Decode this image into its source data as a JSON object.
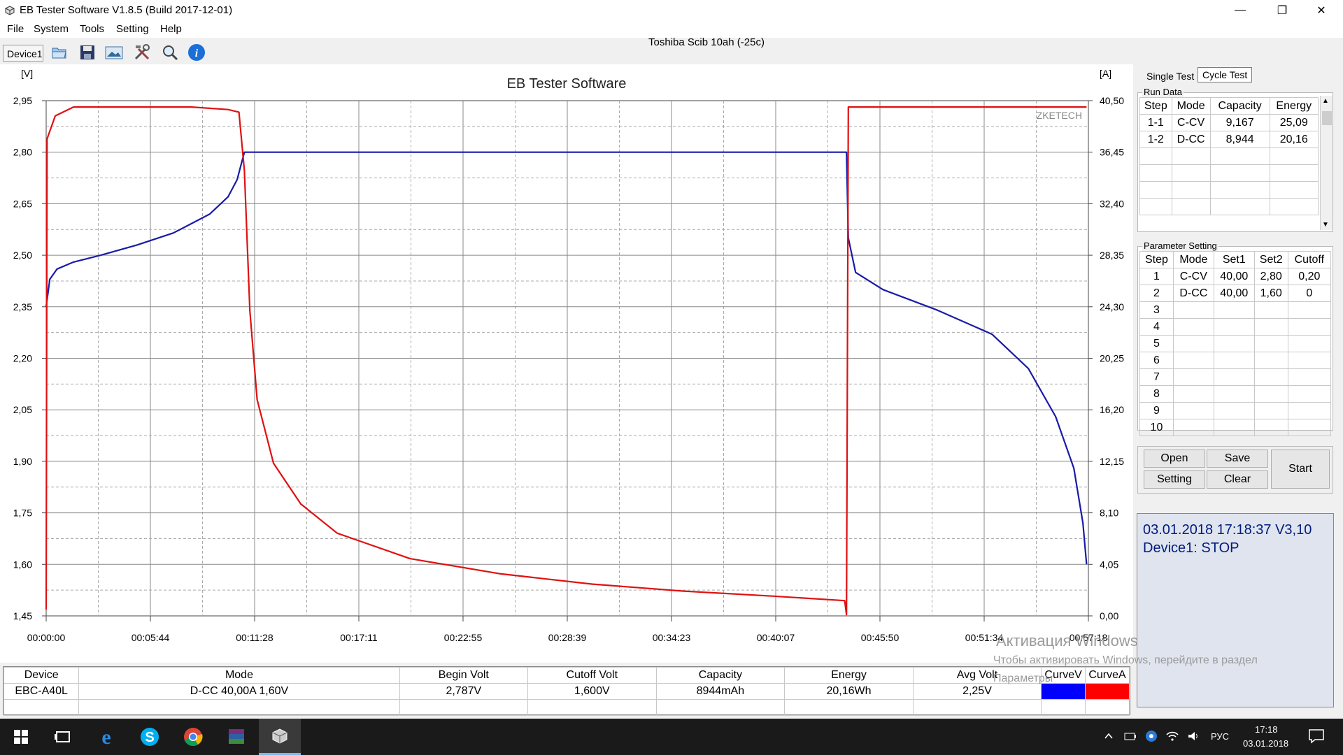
{
  "window": {
    "title": "EB Tester Software V1.8.5 (Build 2017-12-01)",
    "controls": [
      "minimize",
      "restore",
      "close"
    ]
  },
  "menu": [
    "File",
    "System",
    "Tools",
    "Setting",
    "Help"
  ],
  "toolbar": {
    "device_label": "Device1",
    "icons": [
      "open-folder-icon",
      "save-icon",
      "picture-icon",
      "tools-icon",
      "search-icon",
      "info-icon"
    ]
  },
  "document_title": "Toshiba Scib 10ah (-25c)",
  "chart": {
    "title": "EB Tester Software",
    "watermark": "ZKETECH",
    "left_unit": "[V]",
    "right_unit": "[A]",
    "left_ticks": [
      "2,95",
      "2,80",
      "2,65",
      "2,50",
      "2,35",
      "2,20",
      "2,05",
      "1,90",
      "1,75",
      "1,60",
      "1,45"
    ],
    "right_ticks": [
      "40,50",
      "36,45",
      "32,40",
      "28,35",
      "24,30",
      "20,25",
      "16,20",
      "12,15",
      "8,10",
      "4,05",
      "0,00"
    ],
    "x_ticks": [
      "00:00:00",
      "00:05:44",
      "00:11:28",
      "00:17:11",
      "00:22:55",
      "00:28:39",
      "00:34:23",
      "00:40:07",
      "00:45:50",
      "00:51:34",
      "00:57:18"
    ],
    "voltage_color": "#1a1aa8",
    "current_color": "#e01010"
  },
  "chart_data": {
    "type": "line",
    "title": "EB Tester Software",
    "xlabel": "",
    "ylabel": "[V]",
    "y2label": "[A]",
    "x_unit": "minutes",
    "xlim": [
      0,
      57.3
    ],
    "ylim": [
      1.45,
      2.95
    ],
    "y2lim": [
      0,
      40.5
    ],
    "grid": true,
    "series": [
      {
        "name": "",
        "axis": "left",
        "x": [
          0,
          0.2,
          0.6,
          1.5,
          3,
          5,
          7,
          9,
          10,
          10.5,
          10.75,
          10.9,
          11.1,
          20,
          30,
          40,
          43.9,
          44.0,
          44.1,
          44.5,
          46,
          49,
          52,
          54,
          55.5,
          56.5,
          57,
          57.2
        ],
        "y": [
          2.35,
          2.43,
          2.46,
          2.48,
          2.5,
          2.53,
          2.565,
          2.62,
          2.67,
          2.72,
          2.77,
          2.8,
          2.8,
          2.8,
          2.8,
          2.8,
          2.8,
          2.8,
          2.55,
          2.45,
          2.4,
          2.34,
          2.27,
          2.17,
          2.03,
          1.88,
          1.72,
          1.6
        ]
      },
      {
        "name": "",
        "axis": "right",
        "x": [
          0,
          0.05,
          0.5,
          1.5,
          3,
          8,
          10,
          10.6,
          10.9,
          11.2,
          11.6,
          12.5,
          14,
          16,
          20,
          25,
          30,
          35,
          40,
          43.9,
          44.0,
          44.1,
          47,
          52,
          57.2
        ],
        "y": [
          0.5,
          37.5,
          39.3,
          40.0,
          40.0,
          40.0,
          39.8,
          39.6,
          35.0,
          24.0,
          17.0,
          12.0,
          8.8,
          6.5,
          4.5,
          3.3,
          2.5,
          1.95,
          1.55,
          1.2,
          0.1,
          40.0,
          40.0,
          40.0,
          40.0
        ]
      }
    ]
  },
  "right_panel": {
    "tabs": [
      "Single Test",
      "Cycle Test"
    ],
    "run_data": {
      "label": "Run Data",
      "headers": [
        "Step",
        "Mode",
        "Capacity",
        "Energy"
      ],
      "rows": [
        [
          "1-1",
          "C-CV",
          "9,167",
          "25,09"
        ],
        [
          "1-2",
          "D-CC",
          "8,944",
          "20,16"
        ]
      ]
    },
    "parameter_setting": {
      "label": "Parameter Setting",
      "headers": [
        "Step",
        "Mode",
        "Set1",
        "Set2",
        "Cutoff"
      ],
      "rows": [
        [
          "1",
          "C-CV",
          "40,00",
          "2,80",
          "0,20"
        ],
        [
          "2",
          "D-CC",
          "40,00",
          "1,60",
          "0"
        ],
        [
          "3",
          "",
          "",
          "",
          ""
        ],
        [
          "4",
          "",
          "",
          "",
          ""
        ],
        [
          "5",
          "",
          "",
          "",
          ""
        ],
        [
          "6",
          "",
          "",
          "",
          ""
        ],
        [
          "7",
          "",
          "",
          "",
          ""
        ],
        [
          "8",
          "",
          "",
          "",
          ""
        ],
        [
          "9",
          "",
          "",
          "",
          ""
        ],
        [
          "10",
          "",
          "",
          "",
          ""
        ]
      ]
    },
    "buttons": {
      "open": "Open",
      "save": "Save",
      "setting": "Setting",
      "clear": "Clear",
      "start": "Start"
    },
    "status": {
      "line1": "03.01.2018 17:18:37  V3,10",
      "line2": "Device1: STOP"
    }
  },
  "bottom_table": {
    "headers": [
      "Device",
      "Mode",
      "Begin Volt",
      "Cutoff Volt",
      "Capacity",
      "Energy",
      "Avg Volt",
      "CurveV",
      "CurveA"
    ],
    "row": [
      "EBC-A40L",
      "D-CC  40,00A  1,60V",
      "2,787V",
      "1,600V",
      "8944mAh",
      "20,16Wh",
      "2,25V",
      "",
      ""
    ],
    "curve_colors": [
      "#0000ff",
      "#ff0000"
    ]
  },
  "activation_watermark": {
    "line1": "Активация Windows",
    "line2": "Чтобы активировать Windows, перейдите в раздел",
    "line3": "Параметры"
  },
  "taskbar": {
    "apps": [
      "windows-start-icon",
      "task-view-icon",
      "edge-icon",
      "skype-icon",
      "chrome-icon",
      "winrar-icon",
      "eb-tester-icon"
    ],
    "language": "РУС",
    "time": "17:18",
    "date": "03.01.2018"
  }
}
